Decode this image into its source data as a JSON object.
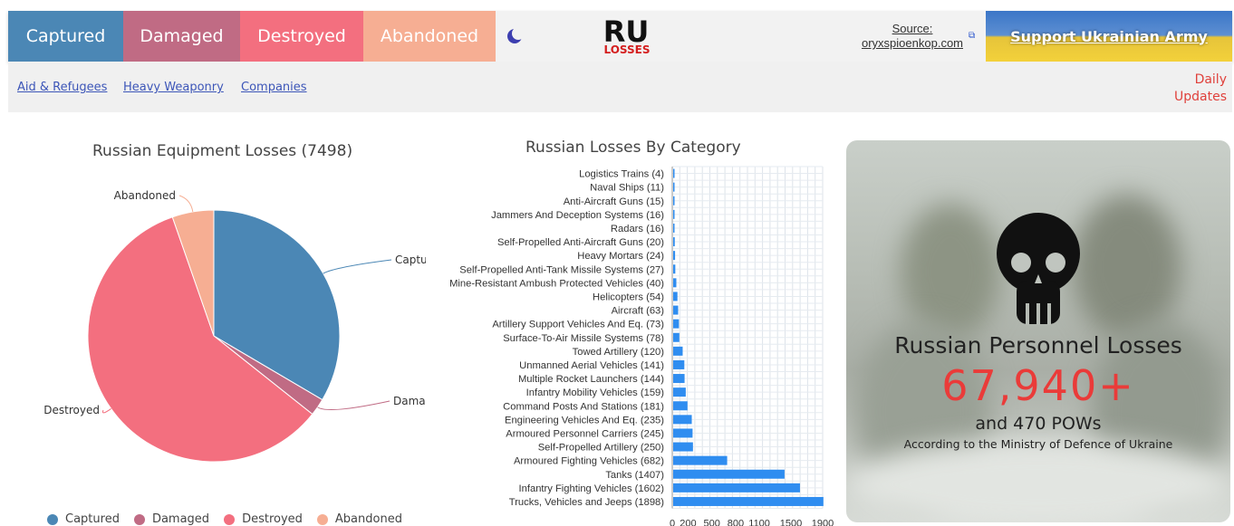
{
  "nav": {
    "tabs": [
      {
        "label": "Captured",
        "color": "#4b87b5"
      },
      {
        "label": "Damaged",
        "color": "#c06b84"
      },
      {
        "label": "Destroyed",
        "color": "#f36f7f"
      },
      {
        "label": "Abandoned",
        "color": "#f6ae93"
      }
    ],
    "theme_toggle_icon": "moon-icon",
    "logo_text_top": "RU",
    "logo_text_bottom": "LOSSES",
    "source_label": "Source:",
    "source_link": "oryxspioenkop.com",
    "support_label": "Support Ukrainian Army"
  },
  "subnav": {
    "links": [
      "Aid & Refugees",
      "Heavy Weaponry",
      "Companies"
    ],
    "daily_line1": "Daily",
    "daily_line2": "Updates"
  },
  "pie_chart": {
    "title": "Russian Equipment Losses (7498)",
    "legend": [
      "Captured",
      "Damaged",
      "Destroyed",
      "Abandoned"
    ]
  },
  "bar_chart": {
    "title": "Russian Losses By Category"
  },
  "personnel": {
    "title": "Russian Personnel Losses",
    "count": "67,940+",
    "pows": "and 470 POWs",
    "note": "According to the Ministry of Defence of Ukraine"
  },
  "chart_data": [
    {
      "type": "pie",
      "title": "Russian Equipment Losses (7498)",
      "labels": [
        "Captured",
        "Damaged",
        "Destroyed",
        "Abandoned"
      ],
      "values": [
        2510,
        166,
        4422,
        400
      ],
      "colors": [
        "#4b87b5",
        "#c06b84",
        "#f36f7f",
        "#f6ae93"
      ],
      "legend": "bottom"
    },
    {
      "type": "bar",
      "orientation": "horizontal",
      "title": "Russian Losses By Category",
      "categories": [
        "Logistics Trains (4)",
        "Naval Ships (11)",
        "Anti-Aircraft Guns (15)",
        "Jammers And Deception Systems (16)",
        "Radars (16)",
        "Self-Propelled Anti-Aircraft Guns (20)",
        "Heavy Mortars (24)",
        "Self-Propelled Anti-Tank Missile Systems (27)",
        "Mine-Resistant Ambush Protected  Vehicles (40)",
        "Helicopters (54)",
        "Aircraft (63)",
        "Artillery Support Vehicles And Eq. (73)",
        "Surface-To-Air Missile Systems (78)",
        "Towed Artillery (120)",
        "Unmanned Aerial Vehicles (141)",
        "Multiple Rocket Launchers (144)",
        "Infantry Mobility Vehicles (159)",
        "Command Posts And  Stations (181)",
        "Engineering Vehicles And Eq. (235)",
        "Armoured Personnel Carriers (245)",
        "Self-Propelled Artillery (250)",
        "Armoured Fighting Vehicles (682)",
        "Tanks (1407)",
        "Infantry Fighting Vehicles (1602)",
        "Trucks, Vehicles and Jeeps (1898)"
      ],
      "values": [
        4,
        11,
        15,
        16,
        16,
        20,
        24,
        27,
        40,
        54,
        63,
        73,
        78,
        120,
        141,
        144,
        159,
        181,
        235,
        245,
        250,
        682,
        1407,
        1602,
        1898
      ],
      "xticks": [
        "0",
        "200",
        "500",
        "800",
        "1100",
        "1500",
        "1900"
      ],
      "xlim": [
        0,
        1900
      ],
      "color": "#2f8df0",
      "grid": true
    }
  ]
}
